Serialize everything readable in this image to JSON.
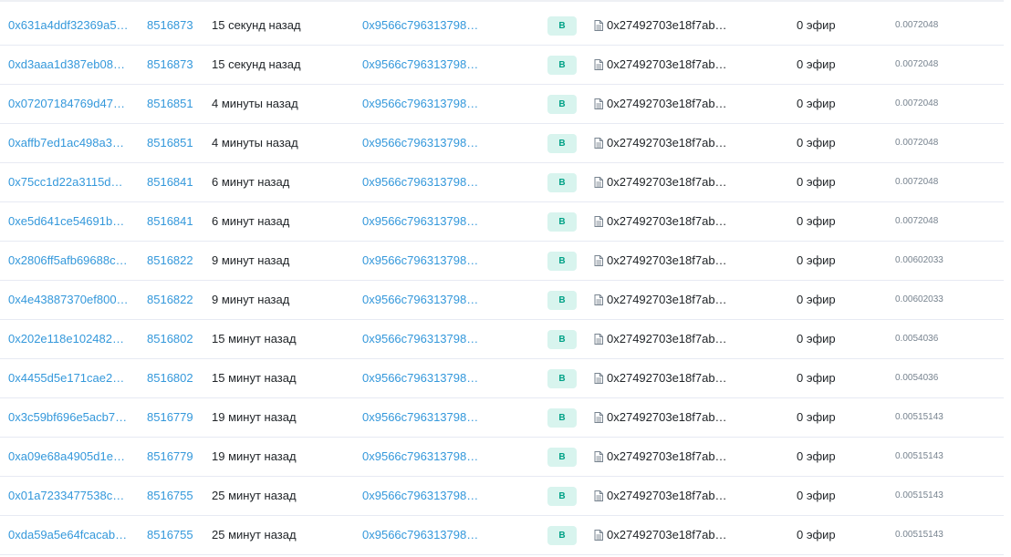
{
  "columns": {
    "direction_label": "В",
    "to_address": "0x27492703e18f7ab…",
    "value": "0 эфир",
    "from_address": "0x9566c796313798…"
  },
  "icons": {
    "contract": "document-icon"
  },
  "colors": {
    "link": "#3498db",
    "badge_bg": "#d8f4ee",
    "badge_text": "#00a186",
    "muted": "#77838f"
  },
  "transactions": [
    {
      "hash": "0x631a4ddf32369a5…",
      "block": "8516873",
      "age": "15 секунд назад",
      "fee": "0.0072048"
    },
    {
      "hash": "0xd3aaa1d387eb08…",
      "block": "8516873",
      "age": "15 секунд назад",
      "fee": "0.0072048"
    },
    {
      "hash": "0x07207184769d47…",
      "block": "8516851",
      "age": "4 минуты назад",
      "fee": "0.0072048"
    },
    {
      "hash": "0xaffb7ed1ac498a3…",
      "block": "8516851",
      "age": "4 минуты назад",
      "fee": "0.0072048"
    },
    {
      "hash": "0x75cc1d22a3115d…",
      "block": "8516841",
      "age": "6 минут назад",
      "fee": "0.0072048"
    },
    {
      "hash": "0xe5d641ce54691b…",
      "block": "8516841",
      "age": "6 минут назад",
      "fee": "0.0072048"
    },
    {
      "hash": "0x2806ff5afb69688c…",
      "block": "8516822",
      "age": "9 минут назад",
      "fee": "0.00602033"
    },
    {
      "hash": "0x4e43887370ef800…",
      "block": "8516822",
      "age": "9 минут назад",
      "fee": "0.00602033"
    },
    {
      "hash": "0x202e118e102482…",
      "block": "8516802",
      "age": "15 минут назад",
      "fee": "0.0054036"
    },
    {
      "hash": "0x4455d5e171cae2…",
      "block": "8516802",
      "age": "15 минут назад",
      "fee": "0.0054036"
    },
    {
      "hash": "0x3c59bf696e5acb7…",
      "block": "8516779",
      "age": "19 минут назад",
      "fee": "0.00515143"
    },
    {
      "hash": "0xa09e68a4905d1e…",
      "block": "8516779",
      "age": "19 минут назад",
      "fee": "0.00515143"
    },
    {
      "hash": "0x01a7233477538c…",
      "block": "8516755",
      "age": "25 минут назад",
      "fee": "0.00515143"
    },
    {
      "hash": "0xda59a5e64fcacab…",
      "block": "8516755",
      "age": "25 минут назад",
      "fee": "0.00515143"
    }
  ]
}
